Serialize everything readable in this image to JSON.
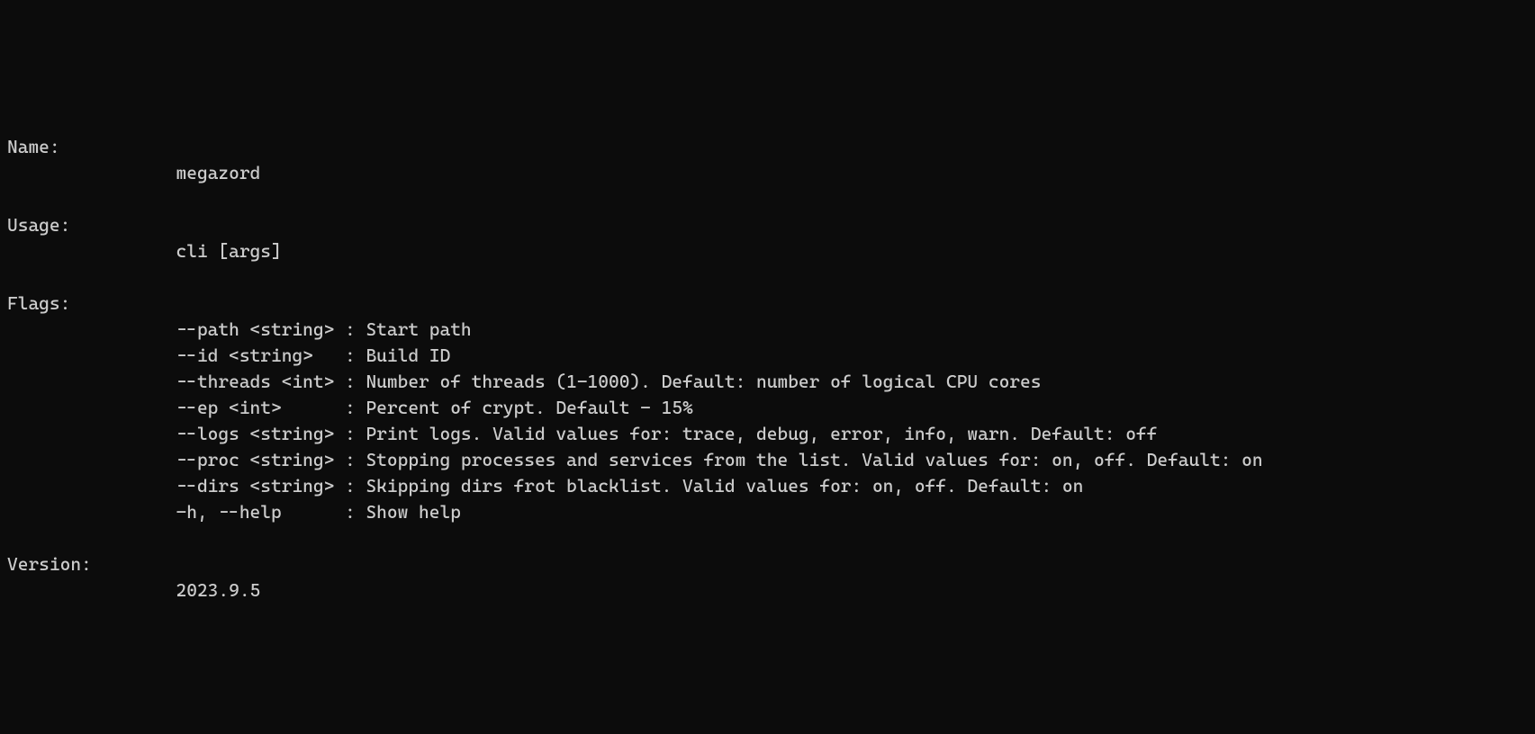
{
  "help": {
    "name_label": "Name:",
    "name_value": "megazord",
    "usage_label": "Usage:",
    "usage_value": "cli [args]",
    "flags_label": "Flags:",
    "flags": [
      "--path <string> : Start path",
      "--id <string>   : Build ID",
      "--threads <int> : Number of threads (1-1000). Default: number of logical CPU cores",
      "--ep <int>      : Percent of crypt. Default - 15%",
      "--logs <string> : Print logs. Valid values for: trace, debug, error, info, warn. Default: off",
      "--proc <string> : Stopping processes and services from the list. Valid values for: on, off. Default: on",
      "--dirs <string> : Skipping dirs frot blacklist. Valid values for: on, off. Default: on",
      "-h, --help      : Show help"
    ],
    "version_label": "Version:",
    "version_value": "2023.9.5"
  }
}
